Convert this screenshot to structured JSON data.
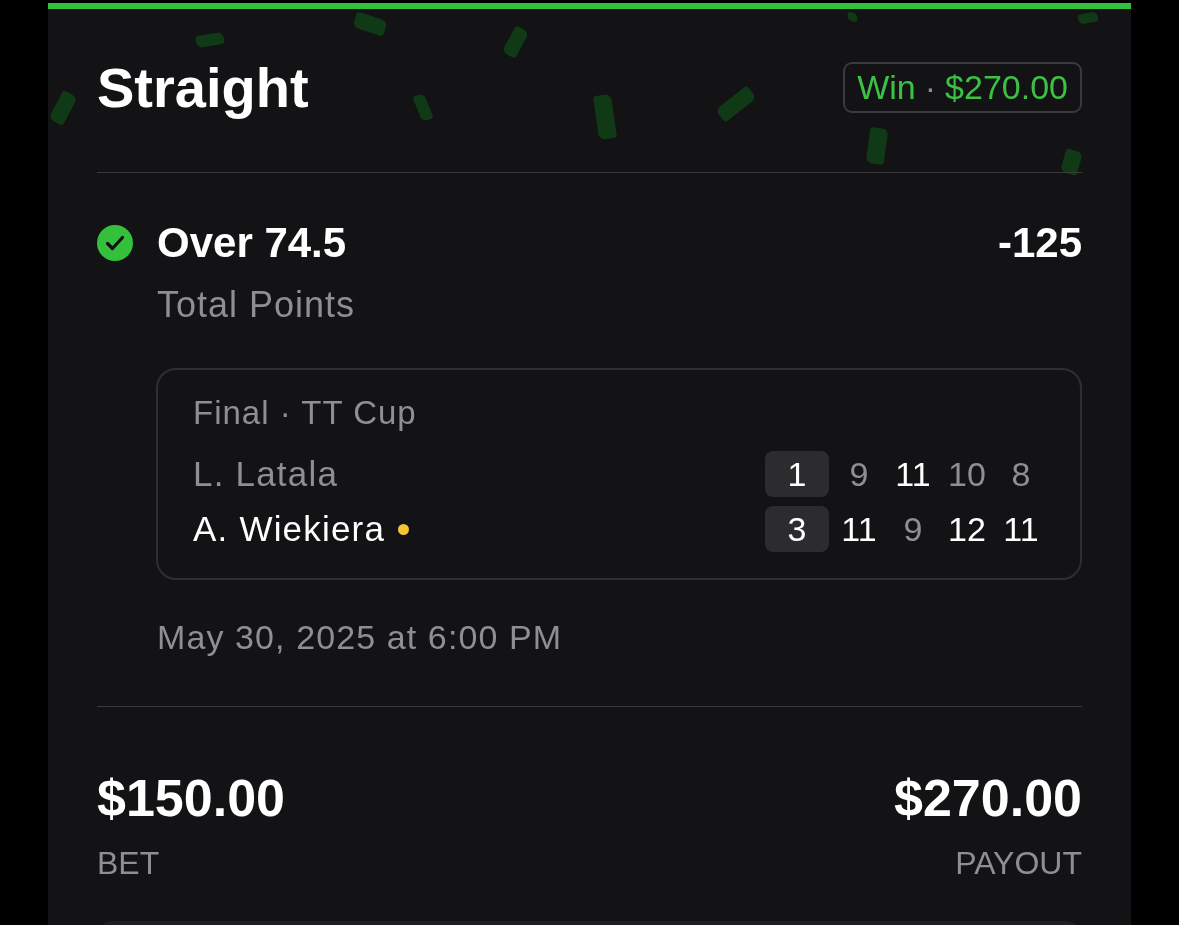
{
  "header": {
    "title": "Straight",
    "badge": {
      "result": "Win",
      "separator": "·",
      "amount": "$270.00"
    }
  },
  "selection": {
    "won": true,
    "pick": "Over 74.5",
    "odds": "-125",
    "market": "Total Points"
  },
  "event": {
    "title": "Final · TT Cup",
    "players": [
      {
        "name": "L. Latala",
        "winner": false,
        "sets": "1",
        "games": [
          {
            "score": "9",
            "won": false
          },
          {
            "score": "11",
            "won": true
          },
          {
            "score": "10",
            "won": false
          },
          {
            "score": "8",
            "won": false
          }
        ]
      },
      {
        "name": "A. Wiekiera",
        "winner": true,
        "sets": "3",
        "games": [
          {
            "score": "11",
            "won": true
          },
          {
            "score": "9",
            "won": false
          },
          {
            "score": "12",
            "won": true
          },
          {
            "score": "11",
            "won": true
          }
        ]
      }
    ]
  },
  "date": "May 30, 2025 at 6:00 PM",
  "totals": [
    {
      "amount": "$150.00",
      "label": "BET"
    },
    {
      "amount": "$270.00",
      "label": "PAYOUT"
    }
  ]
}
